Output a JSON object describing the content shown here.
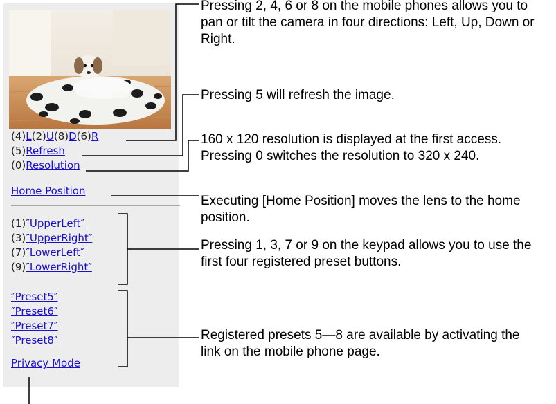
{
  "controls": {
    "pan_prefix_left": "(4)",
    "pan_left": "L",
    "pan_prefix_up": "(2)",
    "pan_up": "U",
    "pan_prefix_down": "(8)",
    "pan_down": "D",
    "pan_prefix_right": "(6)",
    "pan_right": "R",
    "refresh_prefix": "(5)",
    "refresh": "Refresh",
    "resolution_prefix": "(0)",
    "resolution": "Resolution",
    "home_position": "Home Position"
  },
  "presets_keypad": [
    {
      "prefix": "(1)",
      "label": "″UpperLeft″"
    },
    {
      "prefix": "(3)",
      "label": "″UpperRight″"
    },
    {
      "prefix": "(7)",
      "label": "″LowerLeft″"
    },
    {
      "prefix": "(9)",
      "label": "″LowerRight″"
    }
  ],
  "presets_link": [
    "″Preset5″",
    "″Preset6″",
    "″Preset7″",
    "″Preset8″"
  ],
  "privacy_mode": "Privacy Mode",
  "annotations": {
    "pan_tilt": "Pressing 2, 4, 6 or 8 on the mobile phones allows you to pan or tilt the camera in four directions: Left, Up, Down or Right.",
    "refresh": "Pressing 5 will refresh the image.",
    "resolution": "160 x 120 resolution is displayed at the first access. Pressing 0 switches the resolution to 320 x 240.",
    "home": "Executing [Home Position] moves the lens to the home position.",
    "keypad_presets": "Pressing 1, 3, 7 or 9 on the keypad allows you to use the first four registered preset buttons.",
    "link_presets": "Registered presets 5—8 are available by activating the link on the mobile phone page."
  },
  "colors": {
    "link": "#1a10c8",
    "panel": "#ededed"
  }
}
